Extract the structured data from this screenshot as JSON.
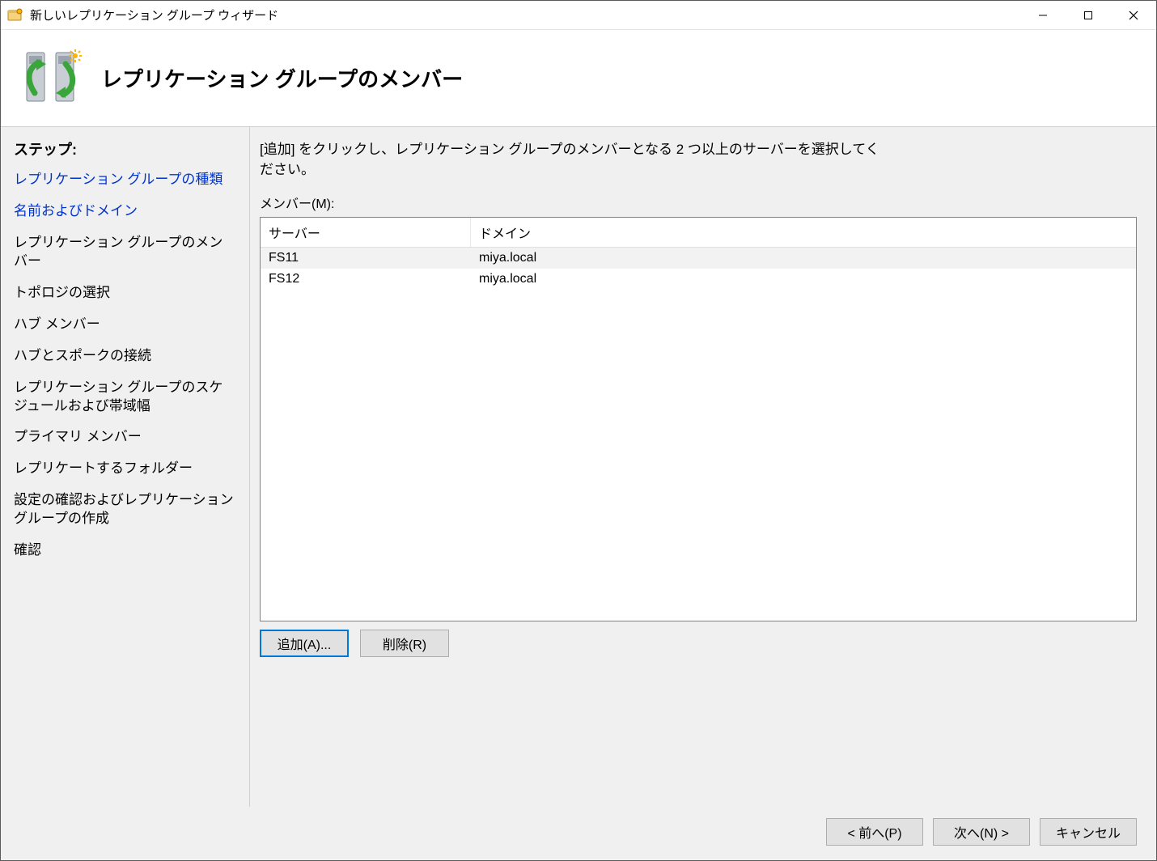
{
  "window": {
    "title": "新しいレプリケーション グループ ウィザード"
  },
  "banner": {
    "title": "レプリケーション グループのメンバー"
  },
  "sidebar": {
    "heading": "ステップ:",
    "steps": [
      {
        "label": "レプリケーション グループの種類",
        "state": "link"
      },
      {
        "label": "名前およびドメイン",
        "state": "link"
      },
      {
        "label": "レプリケーション グループのメンバー",
        "state": "current"
      },
      {
        "label": "トポロジの選択",
        "state": "pending"
      },
      {
        "label": "ハブ メンバー",
        "state": "pending"
      },
      {
        "label": "ハブとスポークの接続",
        "state": "pending"
      },
      {
        "label": "レプリケーション グループのスケジュールおよび帯域幅",
        "state": "pending"
      },
      {
        "label": "プライマリ メンバー",
        "state": "pending"
      },
      {
        "label": "レプリケートするフォルダー",
        "state": "pending"
      },
      {
        "label": "設定の確認およびレプリケーション グループの作成",
        "state": "pending"
      },
      {
        "label": "確認",
        "state": "pending"
      }
    ]
  },
  "main": {
    "instruction": "[追加] をクリックし、レプリケーション グループのメンバーとなる 2 つ以上のサーバーを選択してください。",
    "listLabel": "メンバー(M):",
    "columns": {
      "server": "サーバー",
      "domain": "ドメイン"
    },
    "rows": [
      {
        "server": "FS11",
        "domain": "miya.local",
        "selected": true
      },
      {
        "server": "FS12",
        "domain": "miya.local",
        "selected": false
      }
    ],
    "buttons": {
      "add": "追加(A)...",
      "remove": "削除(R)"
    }
  },
  "footer": {
    "back": "< 前へ(P)",
    "next": "次へ(N) >",
    "cancel": "キャンセル"
  }
}
